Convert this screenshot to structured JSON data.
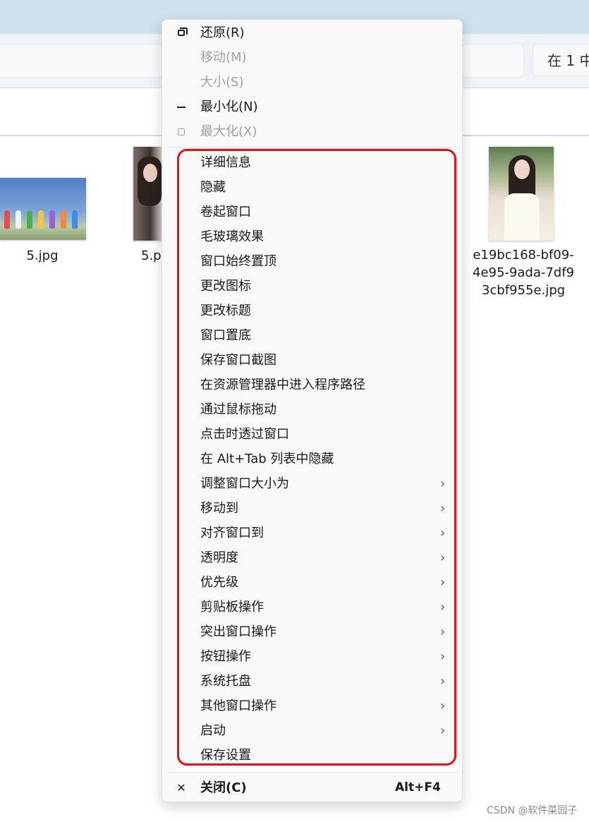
{
  "explorer": {
    "search_text": "在 1 中",
    "files": [
      {
        "name": "5.jpg"
      },
      {
        "name": "5.p"
      },
      {
        "name": "e19bc168-bf09-4e95-9ada-7df93cbf955e.jpg"
      }
    ]
  },
  "menu": {
    "system_items": [
      {
        "label": "还原(R)",
        "icon": "restore-icon",
        "enabled": true
      },
      {
        "label": "移动(M)",
        "icon": "",
        "enabled": false
      },
      {
        "label": "大小(S)",
        "icon": "",
        "enabled": false
      },
      {
        "label": "最小化(N)",
        "icon": "minimize-icon",
        "enabled": true
      },
      {
        "label": "最大化(X)",
        "icon": "maximize-icon",
        "enabled": false
      }
    ],
    "extra_items": [
      {
        "label": "详细信息",
        "submenu": false
      },
      {
        "label": "隐藏",
        "submenu": false
      },
      {
        "label": "卷起窗口",
        "submenu": false
      },
      {
        "label": "毛玻璃效果",
        "submenu": false
      },
      {
        "label": "窗口始终置顶",
        "submenu": false
      },
      {
        "label": "更改图标",
        "submenu": false
      },
      {
        "label": "更改标题",
        "submenu": false
      },
      {
        "label": "窗口置底",
        "submenu": false
      },
      {
        "label": "保存窗口截图",
        "submenu": false
      },
      {
        "label": "在资源管理器中进入程序路径",
        "submenu": false
      },
      {
        "label": "通过鼠标拖动",
        "submenu": false
      },
      {
        "label": "点击时透过窗口",
        "submenu": false
      },
      {
        "label": "在 Alt+Tab 列表中隐藏",
        "submenu": false
      },
      {
        "label": "调整窗口大小为",
        "submenu": true
      },
      {
        "label": "移动到",
        "submenu": true
      },
      {
        "label": "对齐窗口到",
        "submenu": true
      },
      {
        "label": "透明度",
        "submenu": true
      },
      {
        "label": "优先级",
        "submenu": true
      },
      {
        "label": "剪贴板操作",
        "submenu": true
      },
      {
        "label": "突出窗口操作",
        "submenu": true
      },
      {
        "label": "按钮操作",
        "submenu": true
      },
      {
        "label": "系统托盘",
        "submenu": true
      },
      {
        "label": "其他窗口操作",
        "submenu": true
      },
      {
        "label": "启动",
        "submenu": true
      },
      {
        "label": "保存设置",
        "submenu": false
      }
    ],
    "close": {
      "label": "关闭(C)",
      "shortcut": "Alt+F4",
      "icon": "close-icon"
    },
    "chevron_glyph": "›",
    "close_glyph": "✕"
  },
  "watermark": "CSDN @软件菜园子",
  "colors": {
    "highlight": "#e3101a",
    "menu_bg": "#f9f9f9",
    "disabled_text": "#a0a0a0"
  }
}
